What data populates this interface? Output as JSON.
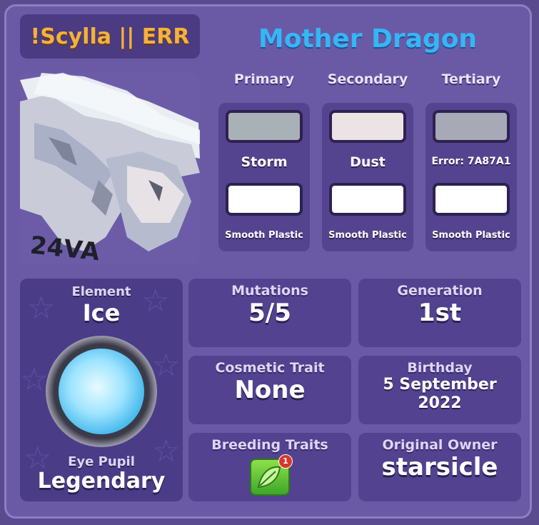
{
  "header": {
    "tag": "!Scylla || ERR",
    "title": "Mother Dragon"
  },
  "portrait": {
    "signature": "24VA"
  },
  "colors": [
    {
      "head": "Primary",
      "color1": "#a9b1b7",
      "name1": "Storm",
      "color2": "#ffffff",
      "name2": "Smooth Plastic"
    },
    {
      "head": "Secondary",
      "color1": "#ece4e4",
      "name1": "Dust",
      "color2": "#ffffff",
      "name2": "Smooth Plastic"
    },
    {
      "head": "Tertiary",
      "color1": "#a7aab6",
      "name1": "Error: 7A87A1",
      "color2": "#ffffff",
      "name2": "Smooth Plastic"
    }
  ],
  "element": {
    "label": "Element",
    "value": "Ice",
    "eye_label": "Eye Pupil",
    "eye_value": "Legendary"
  },
  "stats": {
    "mutations_label": "Mutations",
    "mutations_value": "5/5",
    "generation_label": "Generation",
    "generation_value": "1st",
    "cosmetic_label": "Cosmetic Trait",
    "cosmetic_value": "None",
    "birthday_label": "Birthday",
    "birthday_value_line1": "5 September",
    "birthday_value_line2": "2022",
    "breeding_label": "Breeding Traits",
    "breeding_badge": "1",
    "owner_label": "Original Owner",
    "owner_value": "starsicle"
  }
}
